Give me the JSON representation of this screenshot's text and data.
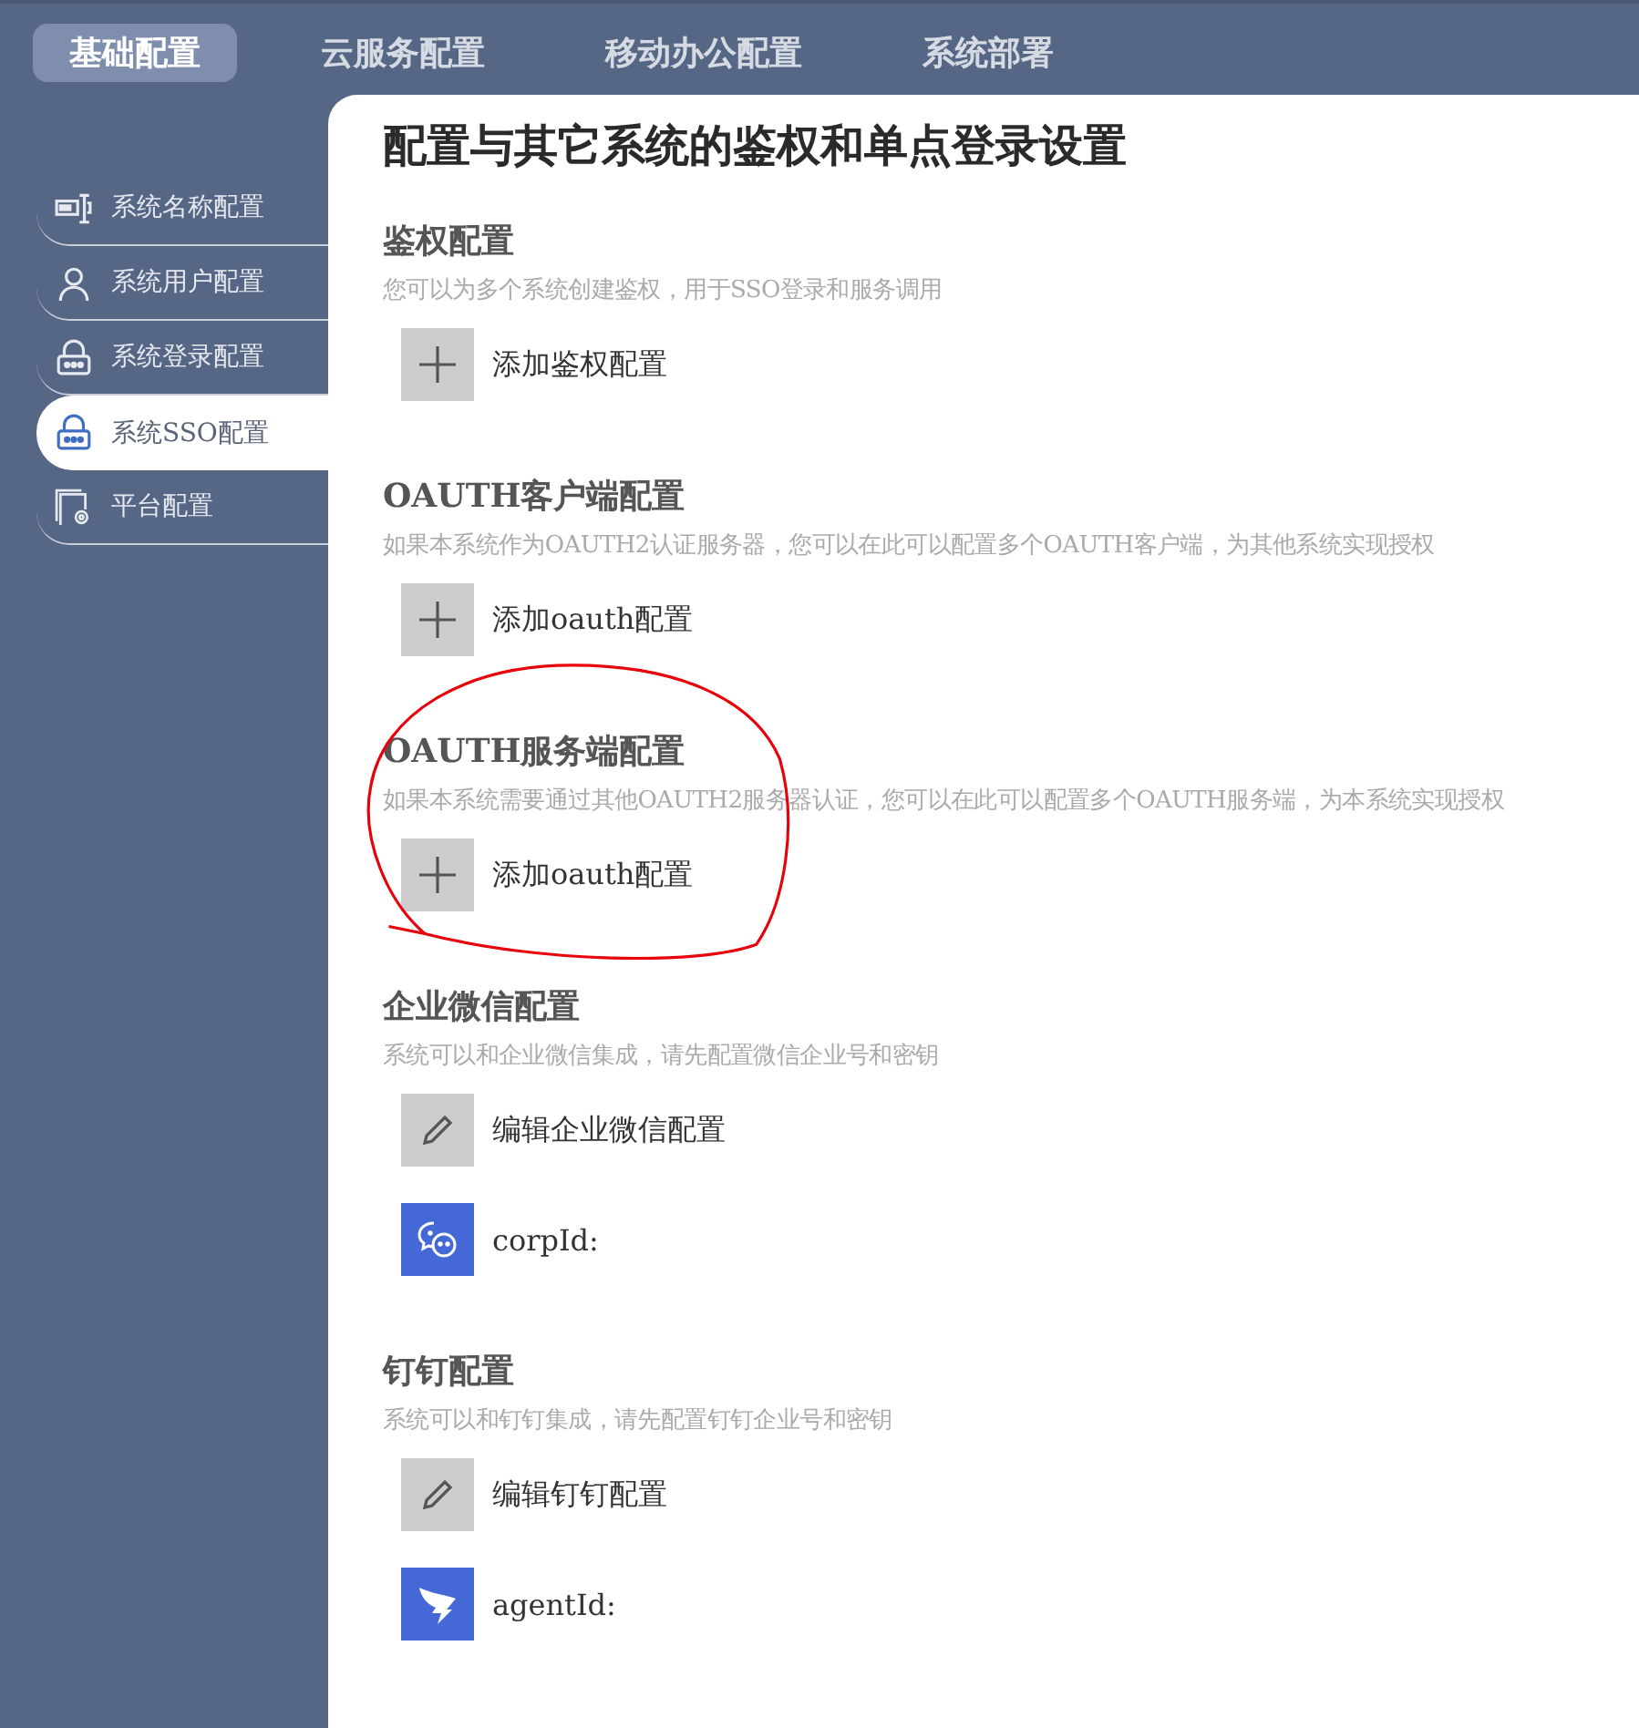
{
  "tabs": [
    {
      "label": "基础配置",
      "selected": true
    },
    {
      "label": "云服务配置",
      "selected": false
    },
    {
      "label": "移动办公配置",
      "selected": false
    },
    {
      "label": "系统部署",
      "selected": false
    }
  ],
  "sidebar": {
    "items": [
      {
        "label": "系统名称配置",
        "kind": "name",
        "selected": false
      },
      {
        "label": "系统用户配置",
        "kind": "user",
        "selected": false
      },
      {
        "label": "系统登录配置",
        "kind": "lock",
        "selected": false
      },
      {
        "label": "系统SSO配置",
        "kind": "lock",
        "selected": true
      },
      {
        "label": "平台配置",
        "kind": "platform",
        "selected": false
      }
    ]
  },
  "page_title": "配置与其它系统的鉴权和单点登录设置",
  "sections": [
    {
      "heading": "鉴权配置",
      "description": "您可以为多个系统创建鉴权，用于SSO登录和服务调用",
      "actions": [
        {
          "kind": "add",
          "label": "添加鉴权配置"
        }
      ]
    },
    {
      "heading": "OAUTH客户端配置",
      "description": "如果本系统作为OAUTH2认证服务器，您可以在此可以配置多个OAUTH客户端，为其他系统实现授权",
      "actions": [
        {
          "kind": "add",
          "label": "添加oauth配置"
        }
      ]
    },
    {
      "heading": "OAUTH服务端配置",
      "description": "如果本系统需要通过其他OAUTH2服务器认证，您可以在此可以配置多个OAUTH服务端，为本系统实现授权",
      "circled": true,
      "actions": [
        {
          "kind": "add",
          "label": "添加oauth配置"
        }
      ]
    },
    {
      "heading": "企业微信配置",
      "description": "系统可以和企业微信集成，请先配置微信企业号和密钥",
      "actions": [
        {
          "kind": "edit",
          "label": "编辑企业微信配置"
        },
        {
          "kind": "wechat",
          "label": "corpId:"
        }
      ]
    },
    {
      "heading": "钉钉配置",
      "description": "系统可以和钉钉集成，请先配置钉钉企业号和密钥",
      "actions": [
        {
          "kind": "edit",
          "label": "编辑钉钉配置"
        },
        {
          "kind": "dingtalk",
          "label": "agentId:"
        }
      ]
    }
  ]
}
